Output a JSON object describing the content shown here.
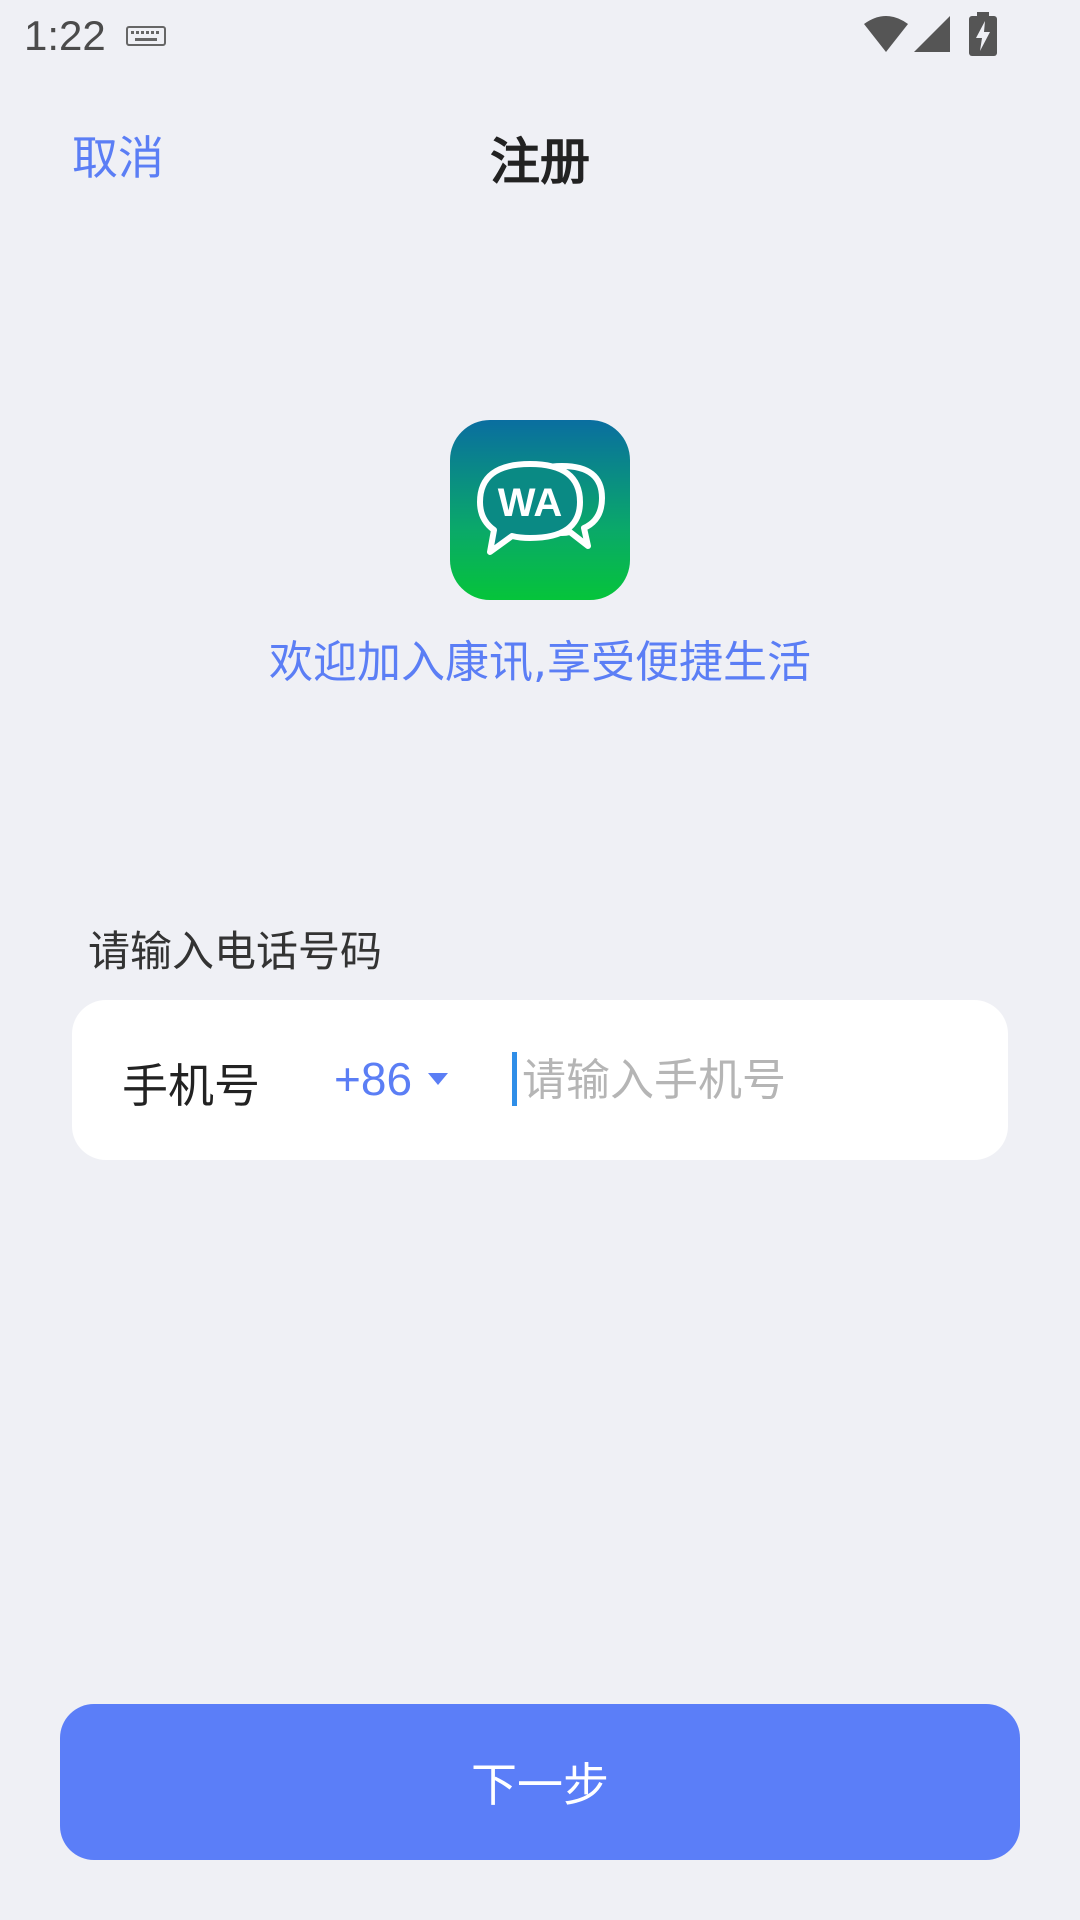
{
  "status_bar": {
    "time": "1:22",
    "icons": [
      "keyboard-icon",
      "wifi-icon",
      "signal-icon",
      "battery-charging-icon"
    ]
  },
  "header": {
    "cancel_label": "取消",
    "title": "注册"
  },
  "logo": {
    "text": "WA",
    "icon": "chat-bubbles-icon",
    "gradient_colors": [
      "#0a6ea0",
      "#05c43a"
    ]
  },
  "welcome": {
    "text": "欢迎加入康讯,享受便捷生活"
  },
  "form": {
    "section_label": "请输入电话号码",
    "phone_label": "手机号",
    "country_code": "+86",
    "phone_value": "",
    "phone_placeholder": "请输入手机号"
  },
  "actions": {
    "next_label": "下一步"
  },
  "colors": {
    "accent": "#5b7ef5",
    "background": "#eff0f5",
    "button": "#5b7ef8"
  }
}
